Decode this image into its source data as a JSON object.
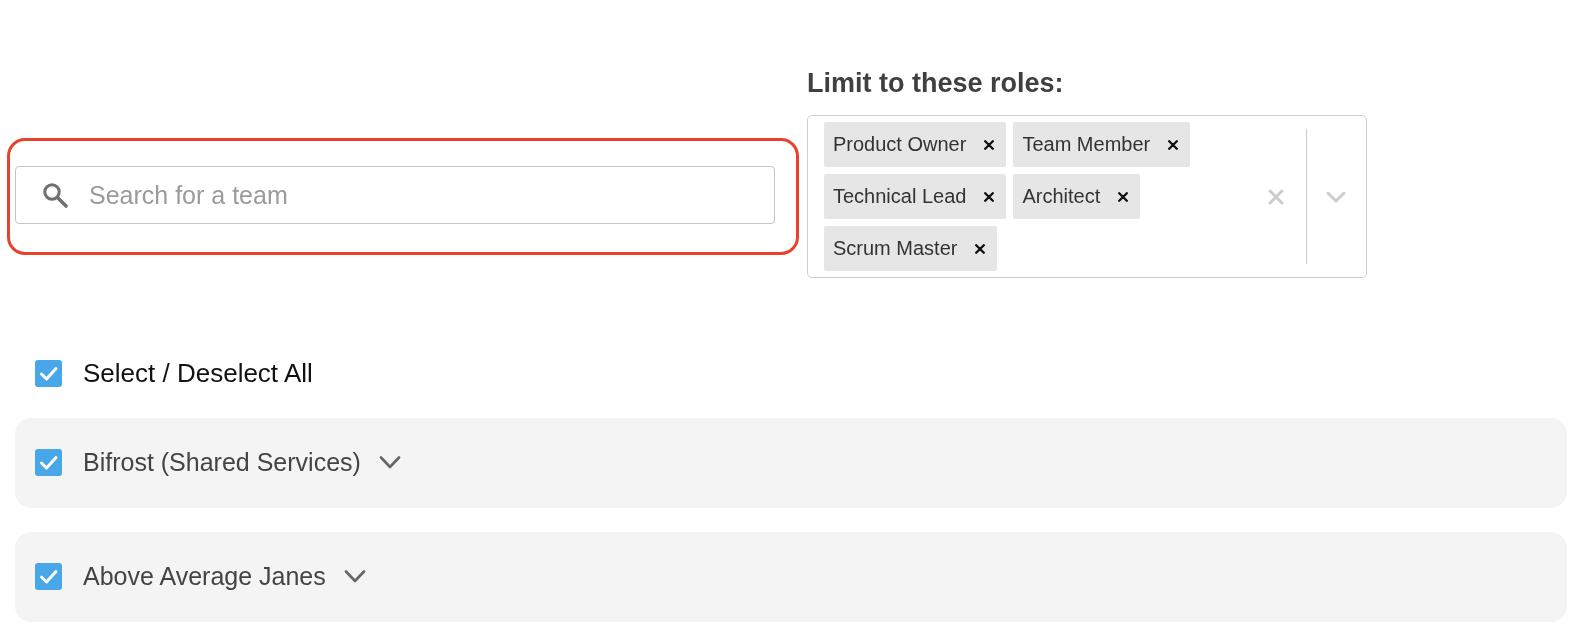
{
  "search": {
    "placeholder": "Search for a team",
    "highlighted": true
  },
  "roles": {
    "label": "Limit to these roles:",
    "selected": [
      {
        "label": "Product Owner"
      },
      {
        "label": "Team Member"
      },
      {
        "label": "Technical Lead"
      },
      {
        "label": "Architect"
      },
      {
        "label": "Scrum Master"
      }
    ]
  },
  "select_all": {
    "label": "Select / Deselect All",
    "checked": true
  },
  "teams": [
    {
      "name": "Bifrost (Shared Services)",
      "checked": true,
      "expanded": false
    },
    {
      "name": "Above Average Janes",
      "checked": true,
      "expanded": false
    }
  ]
}
